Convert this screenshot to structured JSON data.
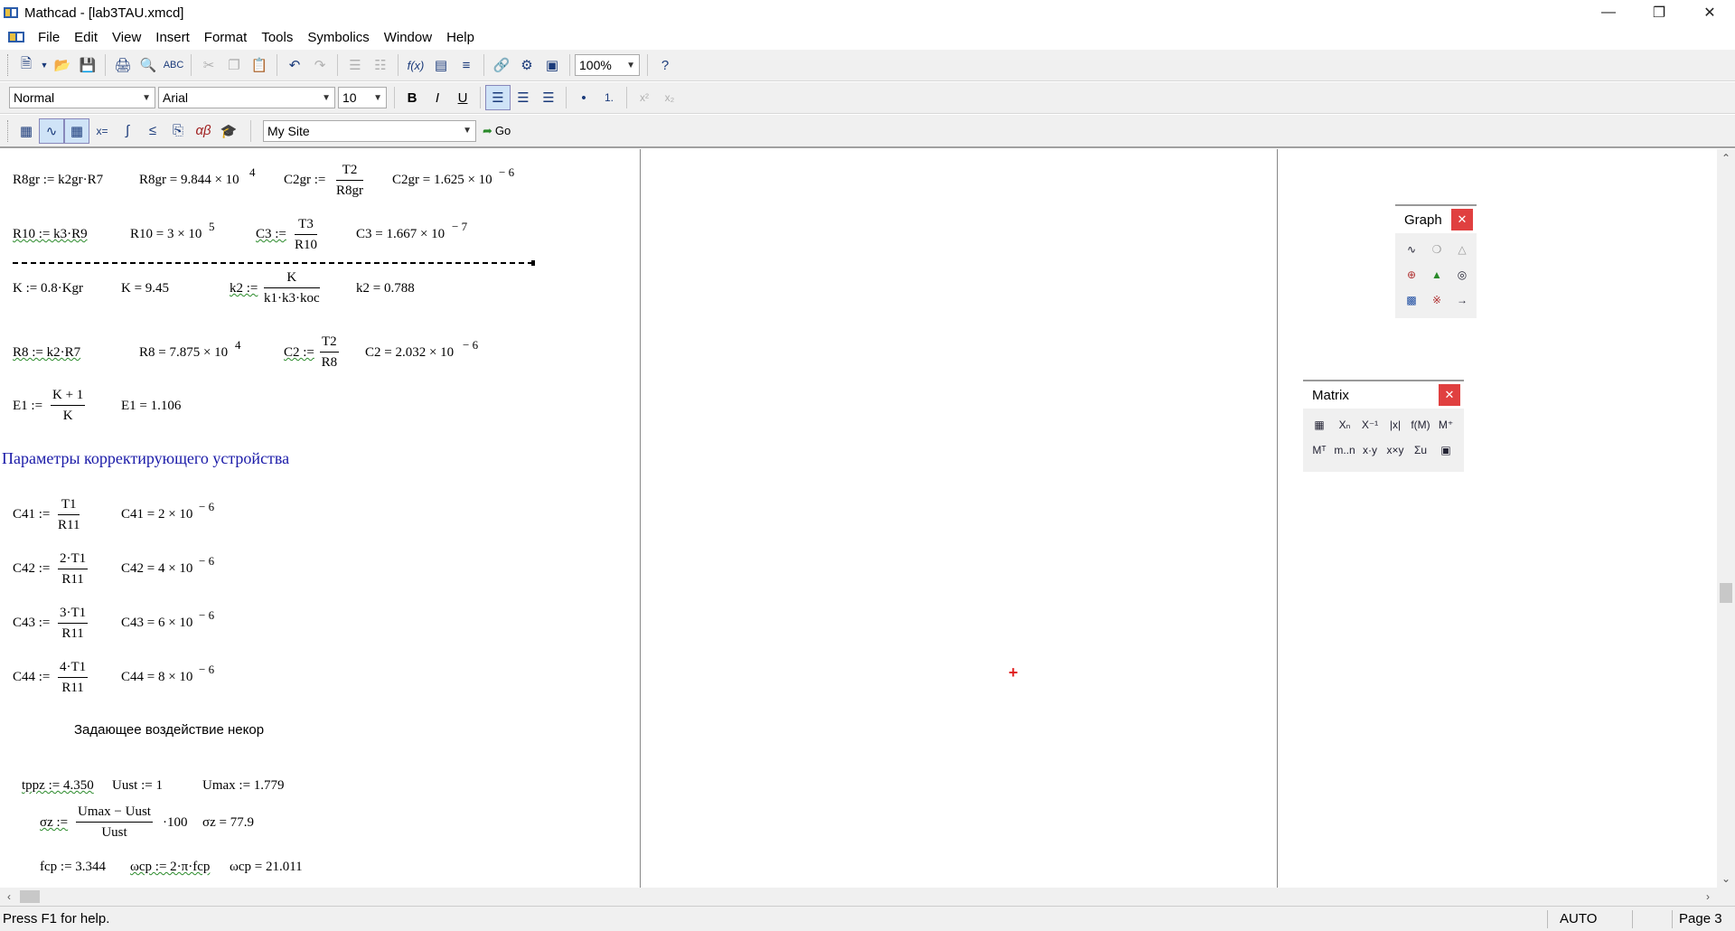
{
  "window": {
    "title": "Mathcad - [lab3TAU.xmcd]",
    "minimize_icon": "minimize-icon",
    "maximize_icon": "restore-icon",
    "close_icon": "close-icon"
  },
  "menu": {
    "items": [
      "File",
      "Edit",
      "View",
      "Insert",
      "Format",
      "Tools",
      "Symbolics",
      "Window",
      "Help"
    ]
  },
  "format_bar": {
    "style": "Normal",
    "font": "Arial",
    "size": "10"
  },
  "math_bar": {
    "site": "My Site",
    "go": "Go",
    "zoom": "100%"
  },
  "worksheet": {
    "row1": {
      "a": "R8gr := k2gr·R7",
      "b": "R8gr = 9.844 × 10",
      "b_exp": "4",
      "c_lhs": "C2gr :=",
      "c_num": "T2",
      "c_den": "R8gr",
      "d": "C2gr = 1.625 × 10",
      "d_exp": "− 6"
    },
    "row2": {
      "a": "R10 := k3·R9",
      "b": "R10 = 3 × 10",
      "b_exp": "5",
      "c_lhs": "C3 :=",
      "c_num": "T3",
      "c_den": "R10",
      "d": "C3 = 1.667 × 10",
      "d_exp": "− 7"
    },
    "row3": {
      "a": "K := 0.8·Kgr",
      "b": "K = 9.45",
      "c_lhs": "k2 :=",
      "c_num": "K",
      "c_den": "k1·k3·koc",
      "d": "k2 = 0.788"
    },
    "row4": {
      "a": "R8 := k2·R7",
      "b": "R8 = 7.875 × 10",
      "b_exp": "4",
      "c_lhs": "C2 :=",
      "c_num": "T2",
      "c_den": "R8",
      "d": "C2 = 2.032 × 10",
      "d_exp": "− 6"
    },
    "row5": {
      "a_lhs": "E1 :=",
      "a_num": "K + 1",
      "a_den": "K",
      "b": "E1 = 1.106"
    },
    "heading": "Параметры корректирующего устройства",
    "c41": {
      "lhs": "C41 :=",
      "num": "T1",
      "den": "R11",
      "res": "C41 = 2 × 10",
      "exp": "− 6"
    },
    "c42": {
      "lhs": "C42 :=",
      "num": "2·T1",
      "den": "R11",
      "res": "C42 = 4 × 10",
      "exp": "− 6"
    },
    "c43": {
      "lhs": "C43 :=",
      "num": "3·T1",
      "den": "R11",
      "res": "C43 = 6 × 10",
      "exp": "− 6"
    },
    "c44": {
      "lhs": "C44 :=",
      "num": "4·T1",
      "den": "R11",
      "res": "C44 = 8 × 10",
      "exp": "− 6"
    },
    "subheading": "Задающее воздействие некор",
    "row_t": {
      "a": "tppz := 4.350",
      "b": "Uust := 1",
      "c": "Umax := 1.779"
    },
    "row_sigma": {
      "lhs": "σz :=",
      "num": "Umax − Uust",
      "den": "Uust",
      "mul": "·100",
      "res": "σz = 77.9"
    },
    "row_f": {
      "a": "fcp := 3.344",
      "b": "ωcp := 2·π·fcp",
      "c": "ωcp = 21.011"
    }
  },
  "palettes": {
    "graph": {
      "title": "Graph",
      "icons": [
        "xy-plot-icon",
        "polar-plot-icon",
        "surface-plot-icon",
        "zoom-icon",
        "contour-plot-icon",
        "trace-icon",
        "bar-plot-3d-icon",
        "scatter-plot-icon",
        "vector-field-icon"
      ]
    },
    "matrix": {
      "title": "Matrix",
      "icons": [
        "matrix-icon",
        "subscript-icon",
        "inverse-icon",
        "determinant-icon",
        "vectorize-icon",
        "column-icon",
        "transpose-icon",
        "range-icon",
        "dot-product-icon",
        "cross-product-icon",
        "vector-sum-icon",
        "picture-icon"
      ]
    }
  },
  "status": {
    "help": "Press F1 for help.",
    "mode": "AUTO",
    "page": "Page 3"
  }
}
